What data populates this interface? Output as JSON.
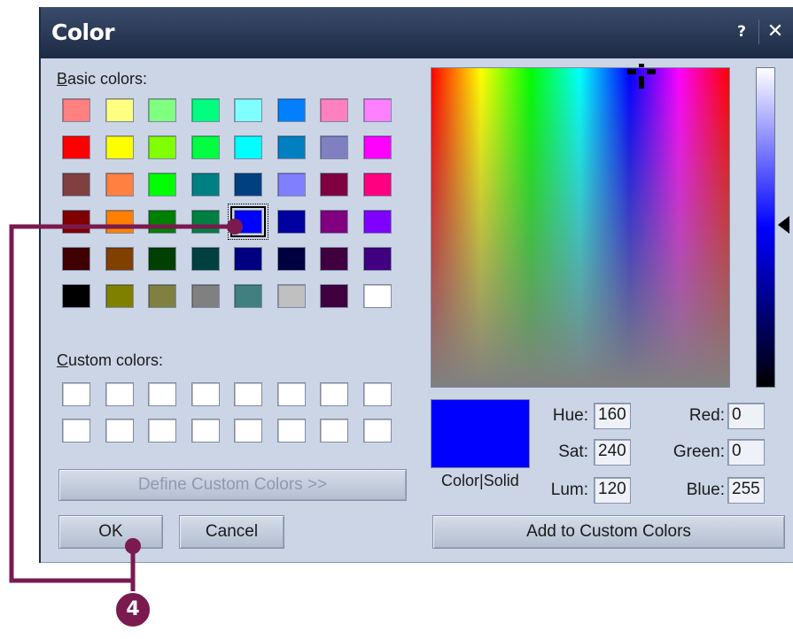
{
  "window": {
    "title": "Color",
    "help_label": "?",
    "close_label": "✕",
    "title_bg": "#1c2a44"
  },
  "basic": {
    "label_first": "B",
    "label_rest": "asic colors:",
    "swatches": [
      [
        "#ff8080",
        "#ffff80",
        "#80ff80",
        "#00ff80",
        "#80ffff",
        "#0080ff",
        "#ff80c0",
        "#ff80ff"
      ],
      [
        "#ff0000",
        "#ffff00",
        "#80ff00",
        "#00ff40",
        "#00ffff",
        "#0080c0",
        "#8080c0",
        "#ff00ff"
      ],
      [
        "#804040",
        "#ff8040",
        "#00ff00",
        "#008080",
        "#004080",
        "#8080ff",
        "#800040",
        "#ff0080"
      ],
      [
        "#800000",
        "#ff8000",
        "#008000",
        "#008040",
        "#0000ff",
        "#0000a0",
        "#800080",
        "#8000ff"
      ],
      [
        "#400000",
        "#804000",
        "#004000",
        "#004040",
        "#000080",
        "#000040",
        "#400040",
        "#400080"
      ],
      [
        "#000000",
        "#808000",
        "#808040",
        "#808080",
        "#408080",
        "#c0c0c0",
        "#400040",
        "#ffffff"
      ]
    ],
    "selected": "r3c4"
  },
  "custom": {
    "label_first": "C",
    "label_rest": "ustom colors:",
    "color": "#ffffff"
  },
  "buttons": {
    "define": "Define Custom Colors >>",
    "ok": "OK",
    "cancel": "Cancel",
    "add": "Add to Custom Colors"
  },
  "fields": {
    "hue_label": "Hue:",
    "sat_label": "Sat:",
    "lum_label": "Lum:",
    "red_label": "Red:",
    "green_label": "Green:",
    "blue_label": "Blue:",
    "hue": "160",
    "sat": "240",
    "lum": "120",
    "red": "0",
    "green": "0",
    "blue": "255"
  },
  "preview": {
    "label": "Color|Solid",
    "color": "#0000ff"
  },
  "annotation": {
    "step": "4",
    "color": "#7a1a4f"
  }
}
